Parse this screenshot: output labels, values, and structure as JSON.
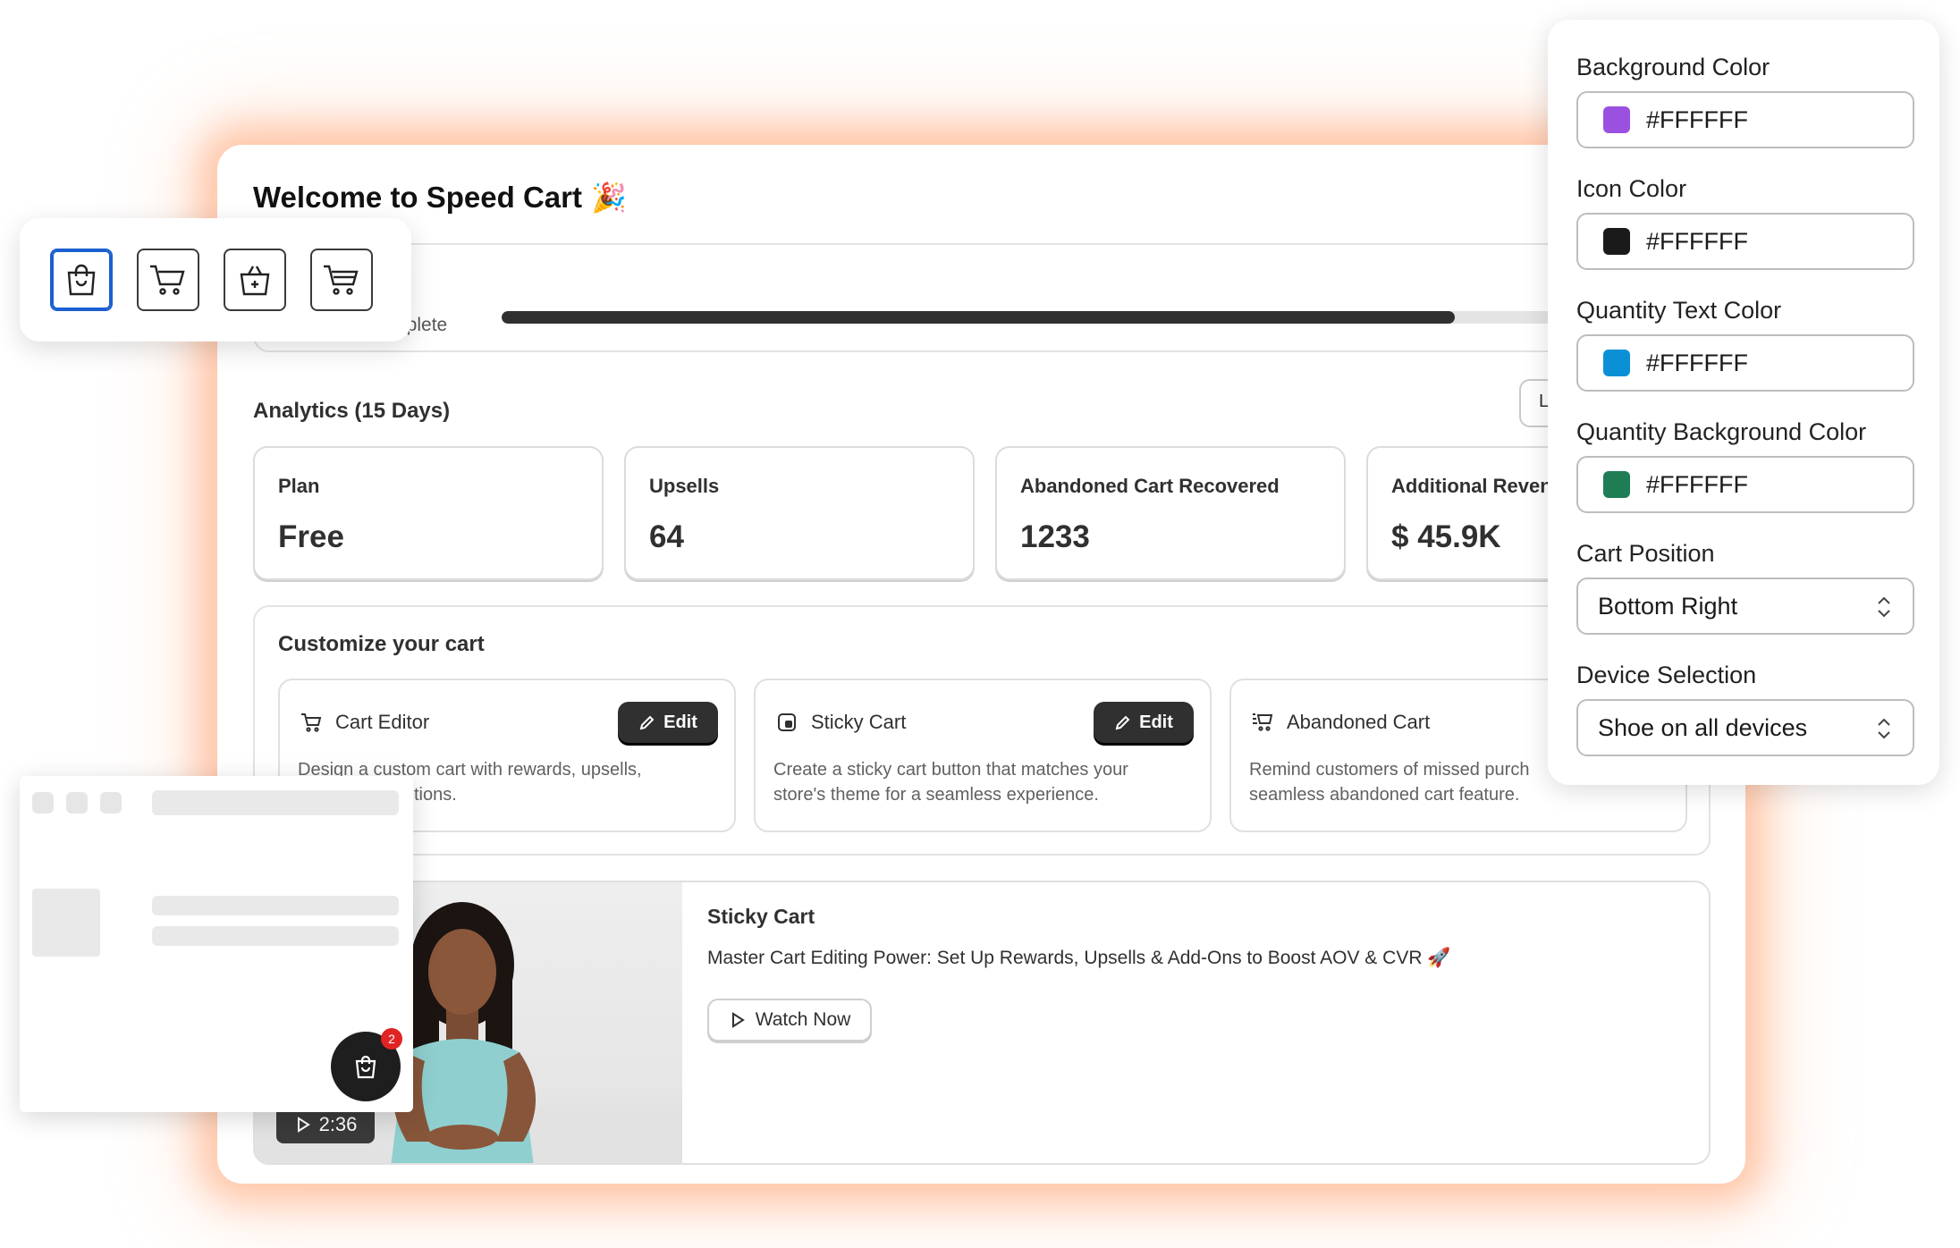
{
  "dashboard": {
    "welcome_title": "Welcome to Speed Cart",
    "welcome_emoji": "🎉",
    "setup": {
      "label_visible": "nplete",
      "progress": 0.74
    },
    "analytics": {
      "title": "Analytics (15 Days)",
      "button_label": "L",
      "stats": [
        {
          "label": "Plan",
          "value": "Free"
        },
        {
          "label": "Upsells",
          "value": "64"
        },
        {
          "label": "Abandoned Cart Recovered",
          "value": "1233"
        },
        {
          "label": "Additional Reven",
          "value": "$ 45.9K"
        }
      ]
    },
    "customize": {
      "title": "Customize your cart",
      "features": [
        {
          "name": "Cart Editor",
          "icon": "cart-icon",
          "button": "Edit",
          "desc_line1": "Design a custom cart with rewards, upsells,",
          "desc_line2": "tions."
        },
        {
          "name": "Sticky Cart",
          "icon": "sticky-icon",
          "button": "Edit",
          "desc_line1": "Create a sticky cart button that matches your",
          "desc_line2": "store's theme for a seamless experience."
        },
        {
          "name": "Abandoned Cart",
          "icon": "abandoned-cart-icon",
          "button": "",
          "desc_line1": "Remind customers of missed purch",
          "desc_line2": "seamless abandoned cart feature."
        }
      ]
    },
    "video": {
      "duration": "2:36",
      "title": "Sticky Cart",
      "description": "Master Cart Editing Power: Set Up Rewards, Upsells & Add-Ons to Boost AOV & CVR 🚀",
      "watch_label": "Watch Now"
    }
  },
  "icon_picker": {
    "options": [
      "shopping-bag-icon",
      "cart-icon",
      "bag-plus-icon",
      "cart-alt-icon"
    ],
    "selected_index": 0
  },
  "preview": {
    "cart_badge_count": "2"
  },
  "settings": {
    "background_color": {
      "label": "Background Color",
      "value": "#FFFFFF",
      "swatch": "#9b51e0"
    },
    "icon_color": {
      "label": "Icon Color",
      "value": "#FFFFFF",
      "swatch": "#1a1a1a"
    },
    "quantity_text_color": {
      "label": "Quantity Text Color",
      "value": "#FFFFFF",
      "swatch": "#0b90d6"
    },
    "quantity_background_color": {
      "label": "Quantity Background Color",
      "value": "#FFFFFF",
      "swatch": "#1e7d55"
    },
    "cart_position": {
      "label": "Cart Position",
      "value": "Bottom Right"
    },
    "device_selection": {
      "label": "Device Selection",
      "value": "Shoe on all devices"
    }
  },
  "colors": {
    "glow": "#ff8c50",
    "selected_outline": "#1a5fd1",
    "dark_button": "#303030"
  }
}
